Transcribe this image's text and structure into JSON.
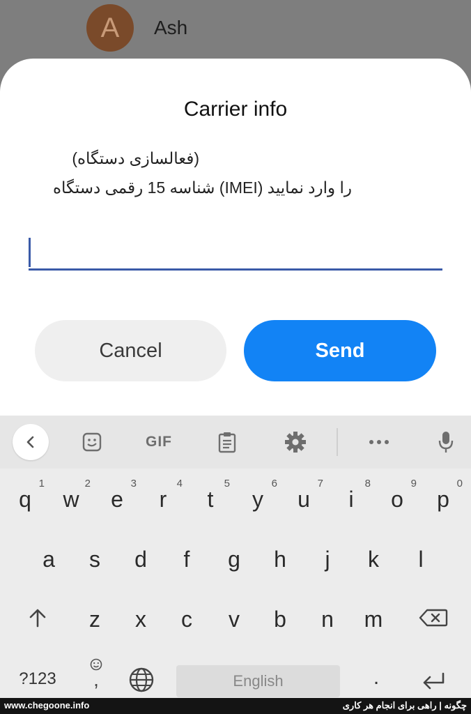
{
  "background": {
    "avatar_letter": "A",
    "contact_name": "Ash"
  },
  "dialog": {
    "title": "Carrier info",
    "message_line1": "(فعالسازی دستگاه)",
    "message_line2": "را وارد نمایید (IMEI) شناسه 15 رقمی دستگاه",
    "input_value": "",
    "cancel_label": "Cancel",
    "send_label": "Send"
  },
  "keyboard": {
    "toolbar": {
      "gif_label": "GIF",
      "icons": [
        "back-chevron-icon",
        "sticker-icon",
        "gif-icon",
        "clipboard-icon",
        "settings-icon",
        "more-icon",
        "microphone-icon"
      ]
    },
    "row1": [
      {
        "key": "q",
        "hint": "1"
      },
      {
        "key": "w",
        "hint": "2"
      },
      {
        "key": "e",
        "hint": "3"
      },
      {
        "key": "r",
        "hint": "4"
      },
      {
        "key": "t",
        "hint": "5"
      },
      {
        "key": "y",
        "hint": "6"
      },
      {
        "key": "u",
        "hint": "7"
      },
      {
        "key": "i",
        "hint": "8"
      },
      {
        "key": "o",
        "hint": "9"
      },
      {
        "key": "p",
        "hint": "0"
      }
    ],
    "row2": [
      "a",
      "s",
      "d",
      "f",
      "g",
      "h",
      "j",
      "k",
      "l"
    ],
    "row3": [
      "z",
      "x",
      "c",
      "v",
      "b",
      "n",
      "m"
    ],
    "symbols_label": "?123",
    "comma_label": ",",
    "space_label": "English",
    "period_label": "."
  },
  "footer": {
    "url": "www.chegoone.info",
    "tagline": "چگونه | راهی برای انجام هر کاری"
  },
  "colors": {
    "accent": "#1283f5",
    "input_underline": "#3a5aa8",
    "overlay": "#7d7d7d"
  }
}
